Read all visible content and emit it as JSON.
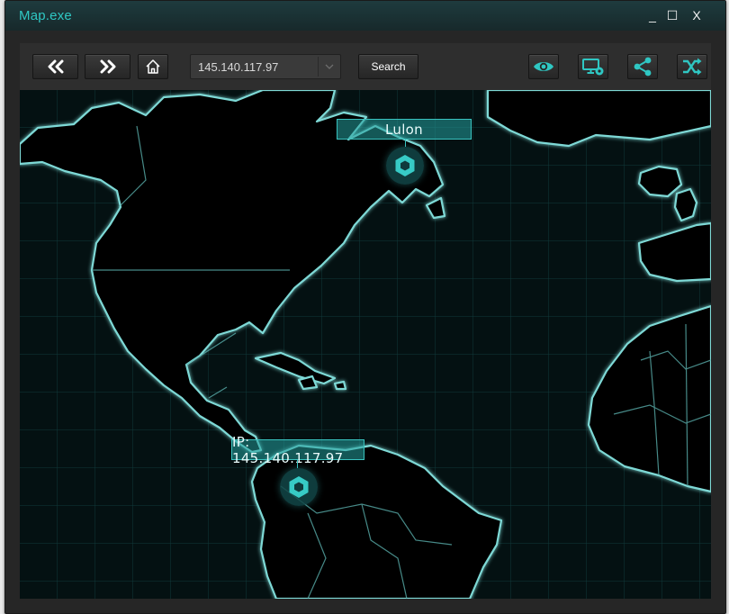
{
  "window": {
    "title": "Map.exe",
    "minimize": "_",
    "maximize": "☐",
    "close": "X"
  },
  "toolbar": {
    "back_icon": "double-chevron-left",
    "forward_icon": "double-chevron-right",
    "home_icon": "home",
    "address_value": "145.140.117.97",
    "search_label": "Search",
    "right_icons": [
      "eye",
      "monitor-settings",
      "share-nodes",
      "shuffle"
    ]
  },
  "map": {
    "markers": [
      {
        "label": "Lulon",
        "icon": "hexagon-node"
      },
      {
        "label": "IP: 145.140.117.97",
        "icon": "hexagon-node"
      }
    ]
  },
  "colors": {
    "accent": "#2fc7c3",
    "coast": "#7ed9d6",
    "map_bg": "#041112"
  }
}
